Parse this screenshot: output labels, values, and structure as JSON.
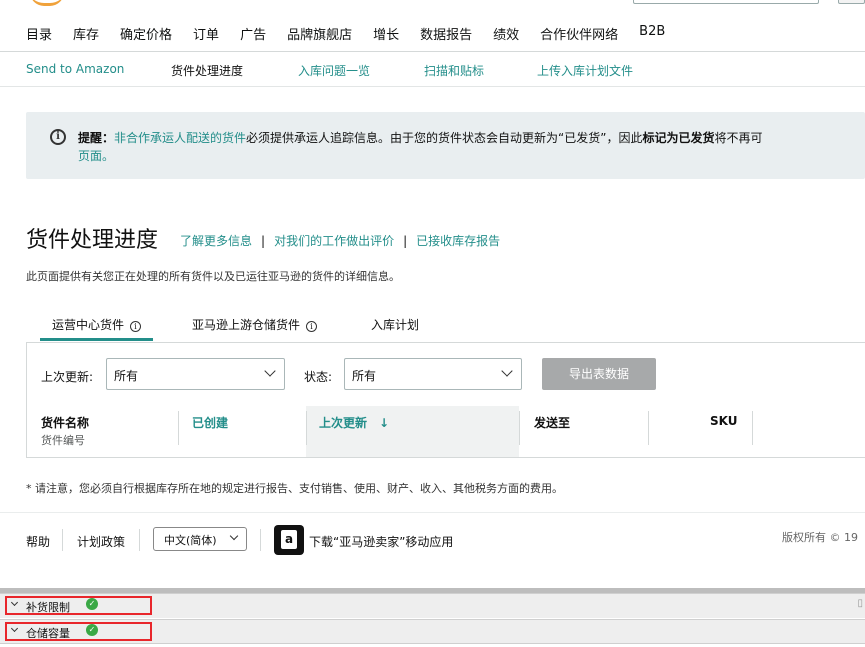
{
  "topnav": {
    "items": [
      "目录",
      "库存",
      "确定价格",
      "订单",
      "广告",
      "品牌旗舰店",
      "增长",
      "数据报告",
      "绩效",
      "合作伙伴网络",
      "B2B"
    ]
  },
  "subnav": {
    "send_to_amazon": "Send to Amazon",
    "shipment_progress": "货件处理进度",
    "inbound_issues": "入库问题一览",
    "scan_label": "扫描和贴标",
    "upload_plan": "上传入库计划文件"
  },
  "alert": {
    "prefix": "提醒：",
    "link": "非合作承运人配送的货件",
    "text1": "必须提供承运人追踪信息。由于您的货件状态会自动更新为“已发货”，因此",
    "bold": "标记为已发货",
    "text2": "将不再可",
    "line2": "页面。"
  },
  "page": {
    "title": "货件处理进度",
    "link_more": "了解更多信息",
    "link_feedback": "对我们的工作做出评价",
    "link_report": "已接收库存报告",
    "description": "此页面提供有关您正在处理的所有货件以及已运往亚马逊的货件的详细信息。"
  },
  "tabs": [
    {
      "label": "运营中心货件"
    },
    {
      "label": "亚马逊上游仓储货件"
    },
    {
      "label": "入库计划"
    }
  ],
  "filters": {
    "last_updated_label": "上次更新:",
    "last_updated_value": "所有",
    "status_label": "状态:",
    "status_value": "所有",
    "export_label": "导出表数据"
  },
  "table": {
    "col_name": "货件名称",
    "col_name_sub": "货件编号",
    "col_created": "已创建",
    "col_updated": "上次更新",
    "col_dest": "发送至",
    "col_sku": "SKU"
  },
  "footnote": "* 请注意，您必须自行根据库存所在地的规定进行报告、支付销售、使用、财产、收入、其他税务方面的费用。",
  "footer": {
    "help": "帮助",
    "policy": "计划政策",
    "language": "中文(简体)",
    "app_glyph": "a",
    "app_download": "下载“亚马逊卖家”移动应用",
    "copyright": "版权所有 © 19"
  },
  "bottom_bars": [
    {
      "label": "补货限制",
      "check": "✓"
    },
    {
      "label": "仓储容量",
      "check": "✓"
    }
  ],
  "colors": {
    "accent": "#238e8a",
    "highlight_red": "#e8262b",
    "check_green": "#3aa845"
  }
}
